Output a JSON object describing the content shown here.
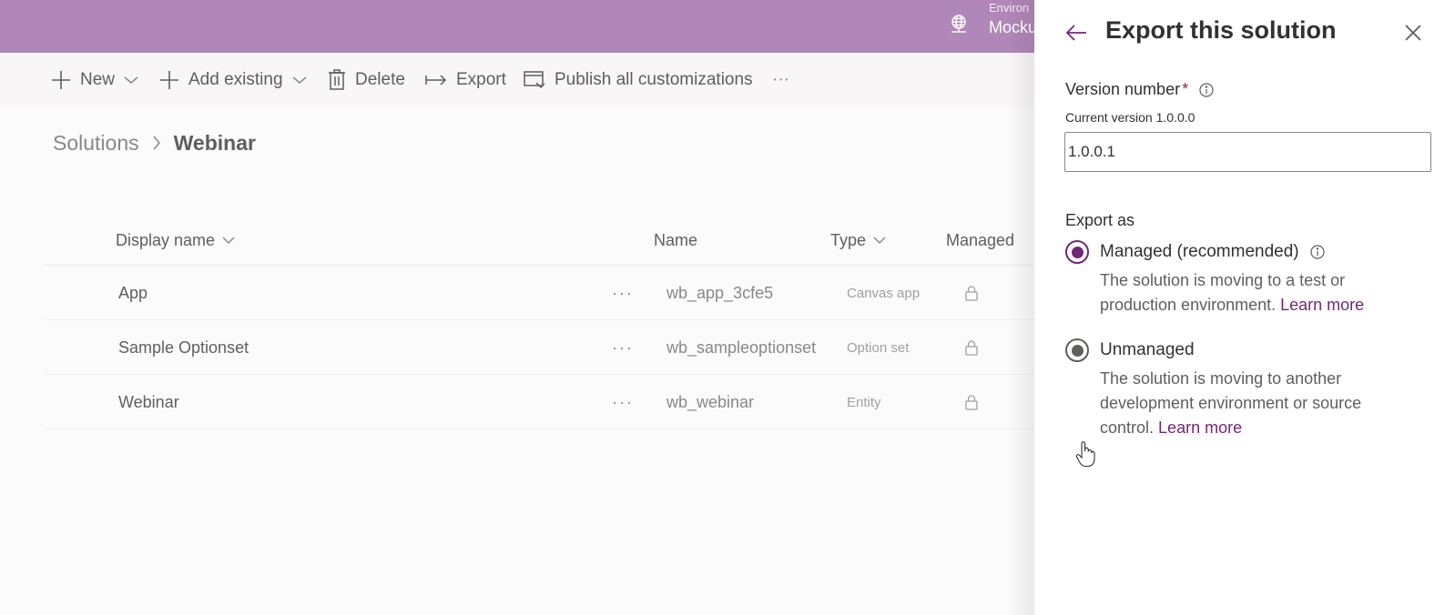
{
  "header": {
    "environment_label": "Environ",
    "environment_name": "Mocku",
    "environment_icon": "globe-network-icon",
    "color": "#b087b8"
  },
  "commandbar": {
    "new_label": "New",
    "add_existing_label": "Add existing",
    "delete_label": "Delete",
    "export_label": "Export",
    "publish_label": "Publish all customizations",
    "more_label": "···"
  },
  "breadcrumb": {
    "root": "Solutions",
    "current": "Webinar"
  },
  "grid": {
    "columns": {
      "display_name": "Display name",
      "name": "Name",
      "type": "Type",
      "managed": "Managed"
    },
    "rows": [
      {
        "display_name": "App",
        "more": "···",
        "name": "wb_app_3cfe5",
        "type": "Canvas app"
      },
      {
        "display_name": "Sample Optionset",
        "more": "···",
        "name": "wb_sampleoptionset",
        "type": "Option set"
      },
      {
        "display_name": "Webinar",
        "more": "···",
        "name": "wb_webinar",
        "type": "Entity"
      }
    ]
  },
  "panel": {
    "title": "Export this solution",
    "version_label": "Version number",
    "required_marker": "*",
    "current_version": "Current version 1.0.0.0",
    "version_value": "1.0.0.1",
    "export_as_label": "Export as",
    "options": [
      {
        "label": "Managed (recommended)",
        "desc": "The solution is moving to a test or production environment.",
        "link": "Learn more",
        "checked": true
      },
      {
        "label": "Unmanaged",
        "desc": "The solution is moving to another development environment or source control.",
        "link": "Learn more",
        "checked": false
      }
    ]
  },
  "colors": {
    "accent": "#742774",
    "selected_dot_managed": "#742774",
    "selected_dot_unmanaged": "#605e5c"
  }
}
